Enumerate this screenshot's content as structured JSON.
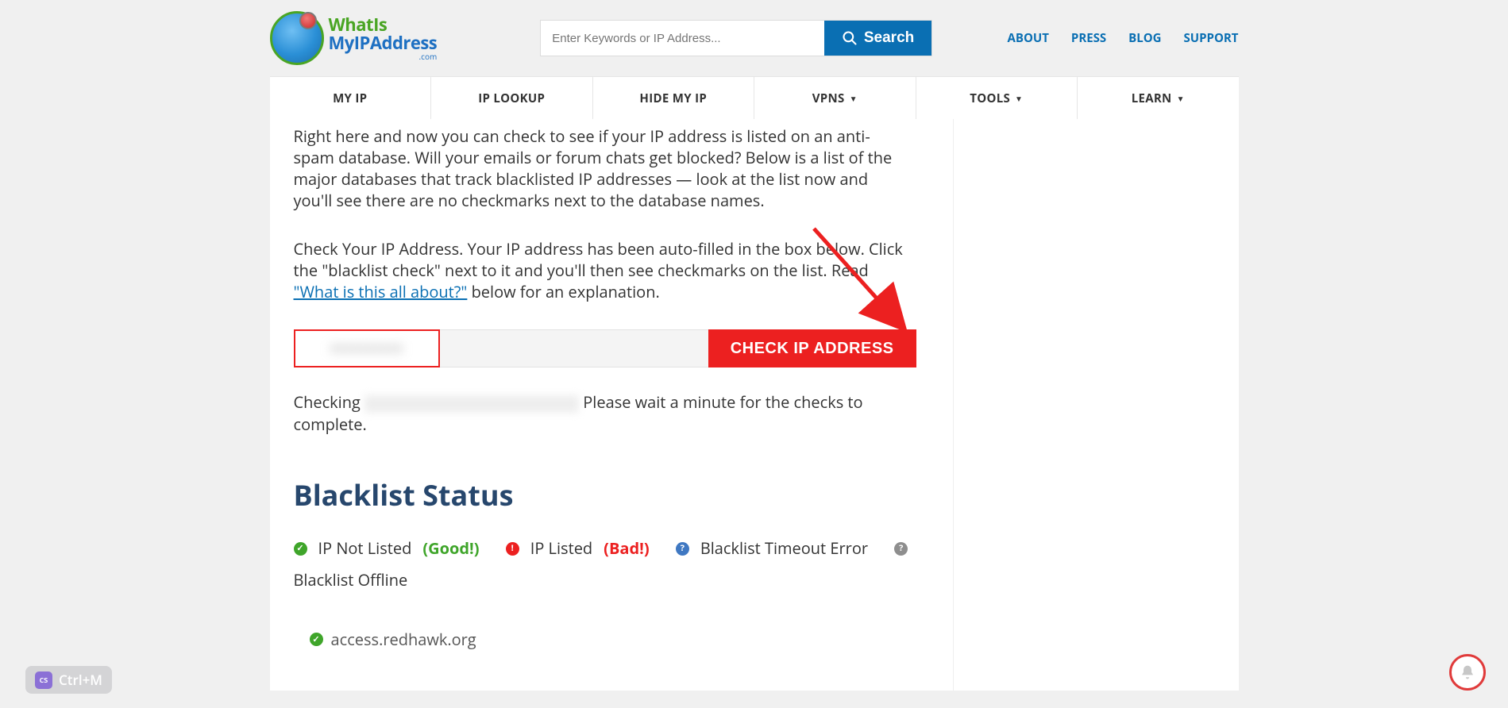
{
  "header": {
    "logo_line1": "WhatIs",
    "logo_line2": "MyIPAddress",
    "logo_line3": ".com",
    "search_placeholder": "Enter Keywords or IP Address...",
    "search_button": "Search",
    "links": {
      "about": "ABOUT",
      "press": "PRESS",
      "blog": "BLOG",
      "support": "SUPPORT"
    }
  },
  "nav": {
    "my_ip": "MY IP",
    "ip_lookup": "IP LOOKUP",
    "hide_my_ip": "HIDE MY IP",
    "vpns": "VPNS",
    "tools": "TOOLS",
    "learn": "LEARN"
  },
  "content": {
    "intro": "Right here and now you can check to see if your IP address is listed on an anti-spam database. Will your emails or forum chats get blocked? Below is a list of the major databases that track blacklisted IP addresses — look at the list now and you'll see there are no checkmarks next to the database names.",
    "check_pre": "Check Your IP Address. Your IP address has been auto-filled in the box below. Click the \"blacklist check\" next to it and you'll then see checkmarks on the list. Read ",
    "check_link": "\"What is this all about?\"",
    "check_post": " below for an explanation.",
    "check_button": "CHECK IP ADDRESS",
    "checking_pre": "Checking ",
    "checking_post": " Please wait a minute for the checks to complete.",
    "blacklist_heading": "Blacklist Status",
    "legend": {
      "not_listed_label": " IP Not Listed ",
      "not_listed_tag": "(Good!)",
      "listed_label": " IP Listed ",
      "listed_tag": "(Bad!)",
      "timeout": " Blacklist Timeout Error",
      "offline": " Blacklist Offline"
    },
    "result_first": "access.redhawk.org"
  },
  "widgets": {
    "ctrlm": "Ctrl+M"
  }
}
